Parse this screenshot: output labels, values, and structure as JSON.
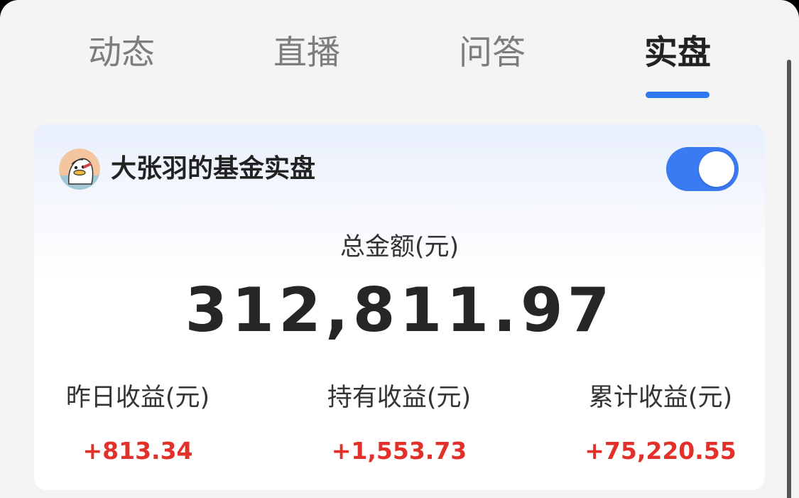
{
  "tabs": [
    {
      "label": "动态"
    },
    {
      "label": "直播"
    },
    {
      "label": "问答"
    },
    {
      "label": "实盘"
    }
  ],
  "active_tab": "实盘",
  "card": {
    "title": "大张羽的基金实盘",
    "toggle_on": true,
    "total_label": "总金额(元)",
    "total_value": "312,811.97",
    "stats": [
      {
        "label": "昨日收益(元)",
        "value": "+813.34"
      },
      {
        "label": "持有收益(元)",
        "value": "+1,553.73"
      },
      {
        "label": "累计收益(元)",
        "value": "+75,220.55"
      }
    ]
  },
  "colors": {
    "accent": "#2f78f2",
    "toggle": "#3a7af2",
    "gain": "#e2302a",
    "tab_inactive": "#7d7d7d",
    "tab_active": "#222222"
  }
}
